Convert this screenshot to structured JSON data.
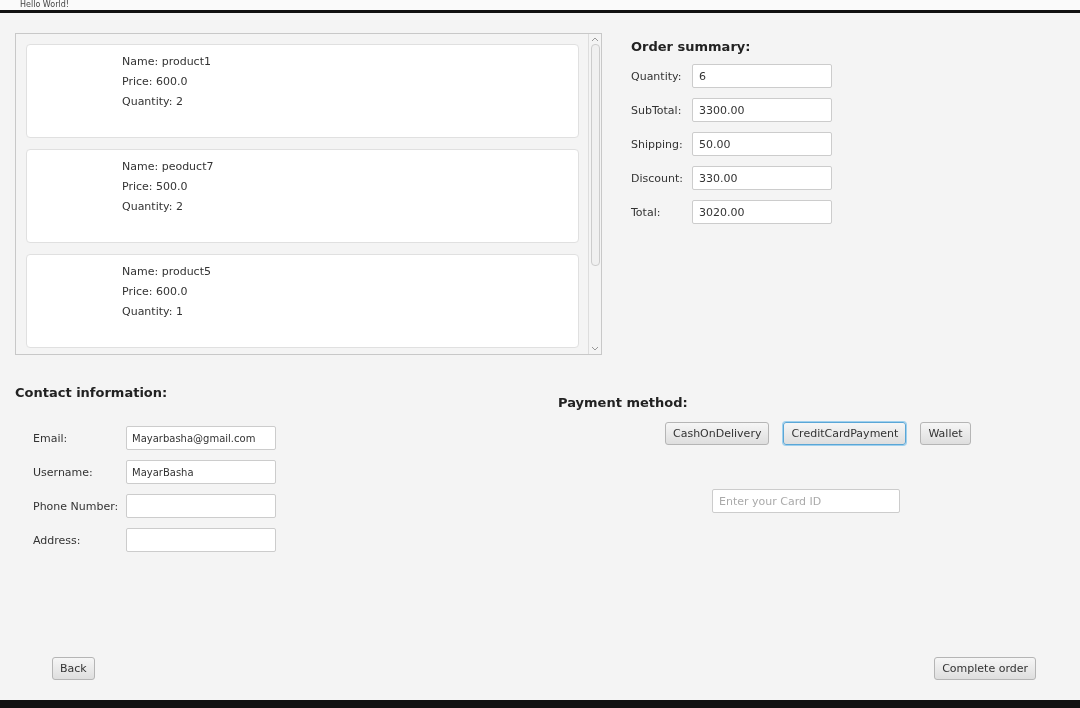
{
  "window": {
    "title": "Hello World!"
  },
  "products": [
    {
      "name": "Name: product1",
      "price": "Price: 600.0",
      "quantity": "Quantity: 2"
    },
    {
      "name": "Name: peoduct7",
      "price": "Price: 500.0",
      "quantity": "Quantity: 2"
    },
    {
      "name": "Name: product5",
      "price": "Price: 600.0",
      "quantity": "Quantity: 1"
    }
  ],
  "order_summary": {
    "title": "Order summary:",
    "fields": [
      {
        "label": "Quantity:",
        "value": "6"
      },
      {
        "label": "SubTotal:",
        "value": "3300.00"
      },
      {
        "label": "Shipping:",
        "value": "50.00"
      },
      {
        "label": "Discount:",
        "value": "330.00"
      },
      {
        "label": "Total:",
        "value": "3020.00"
      }
    ]
  },
  "contact": {
    "title": "Contact information:",
    "fields": [
      {
        "label": "Email:",
        "value": "Mayarbasha@gmail.com"
      },
      {
        "label": "Username:",
        "value": "MayarBasha"
      },
      {
        "label": "Phone Number:"
      },
      {
        "label": "Address:"
      }
    ]
  },
  "payment": {
    "title": "Payment method:",
    "methods": [
      {
        "label": "CashOnDelivery",
        "selected": false
      },
      {
        "label": "CreditCardPayment",
        "selected": true
      },
      {
        "label": "Wallet",
        "selected": false
      }
    ],
    "card_field": {
      "placeholder": "Enter your Card ID"
    }
  },
  "buttons": {
    "back": "Back",
    "complete": "Complete order"
  }
}
